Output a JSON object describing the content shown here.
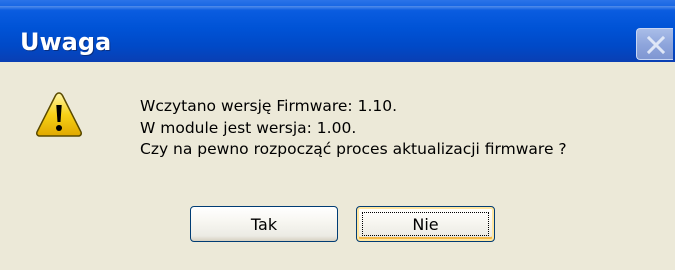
{
  "dialog": {
    "title": "Uwaga",
    "icon": "warning-icon",
    "message_lines": [
      "Wczytano wersję Firmware:  1.10.",
      "W module jest wersja: 1.00.",
      "Czy na pewno rozpocząć proces aktualizacji firmware ?"
    ],
    "buttons": {
      "yes_label": "Tak",
      "no_label": "Nie"
    }
  },
  "colors": {
    "titlebar": "#0053d6",
    "dialog_background": "#ece9d8",
    "button_border": "#003c74",
    "warning_yellow": "#f7d117"
  }
}
